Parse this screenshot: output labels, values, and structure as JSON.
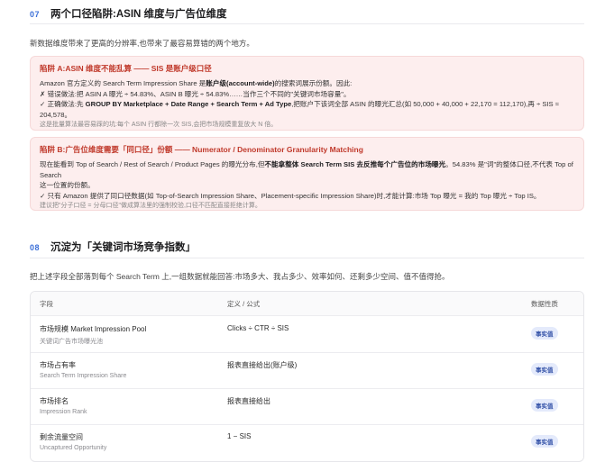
{
  "sec07": {
    "num": "07",
    "title": "两个口径陷阱:ASIN 维度与广告位维度",
    "intro": "新数据维度带来了更高的分辨率,也带来了最容易算错的两个地方。"
  },
  "pitfallA": {
    "title": "陷阱 A:ASIN 维度不能乱算 —— SIS 是账户级口径",
    "l1a": "Amazon 官方定义的 Search Term Impression Share 是",
    "l1b": "账户级(account-wide)",
    "l1c": "的搜索词展示份额。因此:",
    "l2": "✗ 错误做法:把 ASIN A 曝光 ÷ 54.83%、ASIN B 曝光 ÷ 54.83%……当作三个不同的\"关键词市场容量\"。",
    "l3a": "✓ 正确做法:先 ",
    "l3b": "GROUP BY Marketplace + Date Range + Search Term + Ad Type",
    "l3c": ",把账户下该词全部 ASIN 的曝光汇总(如 50,000 + 40,000 + 22,170 = 112,170),再 ÷ SIS ≈ 204,578。",
    "note": "这是批量算法最容易踩的坑:每个 ASIN 行都除一次 SIS,会把市场规模重复放大 N 倍。"
  },
  "pitfallB": {
    "title": "陷阱 B:广告位维度需要「同口径」份额 —— Numerator / Denominator Granularity Matching",
    "l1a": "现在能看到 Top of Search / Rest of Search / Product Pages 的曝光分布,但",
    "l1b": "不能拿整体 Search Term SIS 去反推每个广告位的市场曝光",
    "l1c": "。54.83% 是\"词\"的整体口径,不代表 Top of Search",
    "l2": "这一位置的份额。",
    "l3": "✓ 只有 Amazon 提供了同口径数据(如 Top-of-Search Impression Share、Placement-specific Impression Share)时,才能计算:市场 Top 曝光 = 我的 Top 曝光 ÷ Top IS。",
    "note": "建议把\"分子口径 = 分母口径\"做成算法里的强制校验,口径不匹配直接拒绝计算。"
  },
  "sec08": {
    "num": "08",
    "title": "沉淀为「关键词市场竞争指数」",
    "intro": "把上述字段全部落到每个 Search Term 上,一组数据就能回答:市场多大、我占多少、效率如何、还剩多少空间、值不值得抢。"
  },
  "table": {
    "headers": [
      "字段",
      "定义 / 公式",
      "数据性质"
    ],
    "rows": [
      {
        "name": "市场规模 Market Impression Pool",
        "sub": "关键词广告市场曝光池",
        "def": "Clicks ÷ CTR ÷ SIS",
        "badge": "事实值"
      },
      {
        "name": "市场占有率",
        "sub": "Search Term Impression Share",
        "def": "报表直接给出(账户级)",
        "badge": "事实值"
      },
      {
        "name": "市场排名",
        "sub": "Impression Rank",
        "def": "报表直接给出",
        "badge": "事实值"
      },
      {
        "name": "剩余流量空间",
        "sub": "Uncaptured Opportunity",
        "def": "1 − SIS",
        "badge": "事实值"
      }
    ]
  }
}
